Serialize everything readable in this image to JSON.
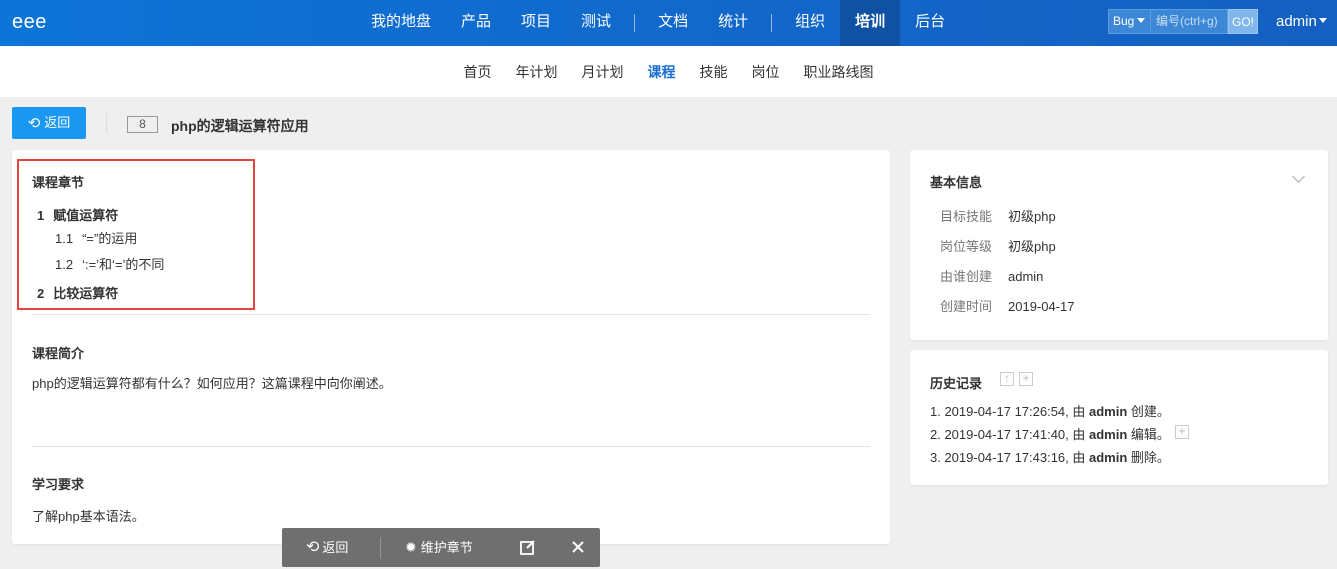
{
  "header": {
    "brand": "eee",
    "nav": [
      {
        "label": "我的地盘"
      },
      {
        "label": "产品"
      },
      {
        "label": "项目"
      },
      {
        "label": "测试"
      },
      {
        "label": "文档"
      },
      {
        "label": "统计"
      },
      {
        "label": "组织"
      },
      {
        "label": "培训"
      },
      {
        "label": "后台"
      }
    ],
    "active_nav": "培训",
    "search": {
      "type": "Bug",
      "placeholder": "编号(ctrl+g)",
      "go": "GO!"
    },
    "user": "admin"
  },
  "subnav": {
    "items": [
      {
        "label": "首页"
      },
      {
        "label": "年计划"
      },
      {
        "label": "月计划"
      },
      {
        "label": "课程"
      },
      {
        "label": "技能"
      },
      {
        "label": "岗位"
      },
      {
        "label": "职业路线图"
      }
    ],
    "active": "课程"
  },
  "titlebar": {
    "back": "返回",
    "id": "8",
    "title": "php的逻辑运算符应用"
  },
  "course": {
    "chapters_title": "课程章节",
    "chapters": [
      {
        "num": "1",
        "title": "赋值运算符",
        "level": 1
      },
      {
        "num": "1.1",
        "title": "“=”的运用",
        "level": 2
      },
      {
        "num": "1.2",
        "title": "‘:=’和‘=’的不同",
        "level": 2
      },
      {
        "num": "2",
        "title": "比较运算符",
        "level": 1
      }
    ],
    "intro_title": "课程简介",
    "intro": "php的逻辑运算符都有什么？如何应用？这篇课程中向你阐述。",
    "req_title": "学习要求",
    "req": "了解php基本语法。"
  },
  "basic_info": {
    "title": "基本信息",
    "rows": [
      {
        "label": "目标技能",
        "value": "初级php"
      },
      {
        "label": "岗位等级",
        "value": "初级php"
      },
      {
        "label": "由谁创建",
        "value": "admin"
      },
      {
        "label": "创建时间",
        "value": "2019-04-17"
      }
    ]
  },
  "history": {
    "title": "历史记录",
    "items": [
      {
        "prefix": "1. 2019-04-17 17:26:54, 由 ",
        "user": "admin",
        "action": " 创建。"
      },
      {
        "prefix": "2. 2019-04-17 17:41:40, 由 ",
        "user": "admin",
        "action": " 编辑。"
      },
      {
        "prefix": "3. 2019-04-17 17:43:16, 由 ",
        "user": "admin",
        "action": " 删除。"
      }
    ]
  },
  "toolbar": {
    "back": "返回",
    "maintain": "维护章节"
  }
}
